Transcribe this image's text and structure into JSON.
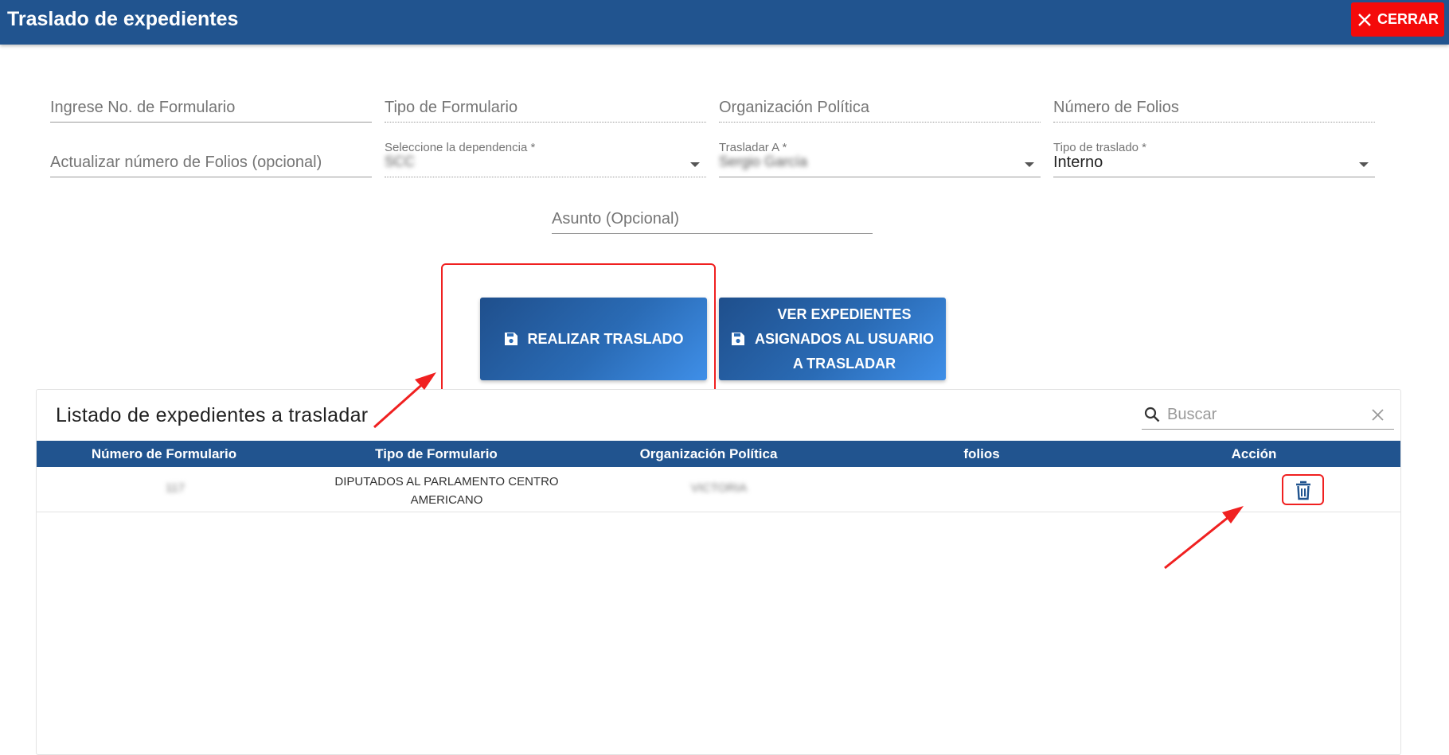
{
  "header": {
    "title": "Traslado de expedientes",
    "close_label": "CERRAR"
  },
  "form": {
    "formulario_placeholder": "Ingrese No. de Formulario",
    "tipo_placeholder": "Tipo de Formulario",
    "organizacion_placeholder": "Organización Política",
    "folios_placeholder": "Número de Folios",
    "actualizar_folios_placeholder": "Actualizar número de Folios (opcional)",
    "dependencia_label": "Seleccione la dependencia *",
    "dependencia_value": "SCC",
    "trasladar_label": "Trasladar A *",
    "trasladar_value": "Sergio García",
    "tipo_traslado_label": "Tipo de traslado *",
    "tipo_traslado_value": "Interno",
    "asunto_placeholder": "Asunto (Opcional)"
  },
  "actions": {
    "realizar_label": "REALIZAR TRASLADO",
    "ver_line1": "VER EXPEDIENTES",
    "ver_line2": "ASIGNADOS AL USUARIO",
    "ver_line3": "A TRASLADAR"
  },
  "list": {
    "title": "Listado de expedientes a trasladar",
    "search_placeholder": "Buscar",
    "columns": [
      "Número de Formulario",
      "Tipo de Formulario",
      "Organización Política",
      "folios",
      "Acción"
    ],
    "rows": [
      {
        "numero": "117",
        "tipo_line1": "DIPUTADOS AL PARLAMENTO CENTRO",
        "tipo_line2": "AMERICANO",
        "organizacion": "VICTORIA",
        "folios": ""
      }
    ]
  },
  "icons": {
    "close": "close-icon",
    "save": "floppy-disk-icon",
    "search": "search-icon",
    "clear": "clear-icon",
    "delete": "trash-icon"
  },
  "colors": {
    "header_bg": "#21548f",
    "close_bg": "#f40a0a",
    "annotation": "#f02020"
  }
}
